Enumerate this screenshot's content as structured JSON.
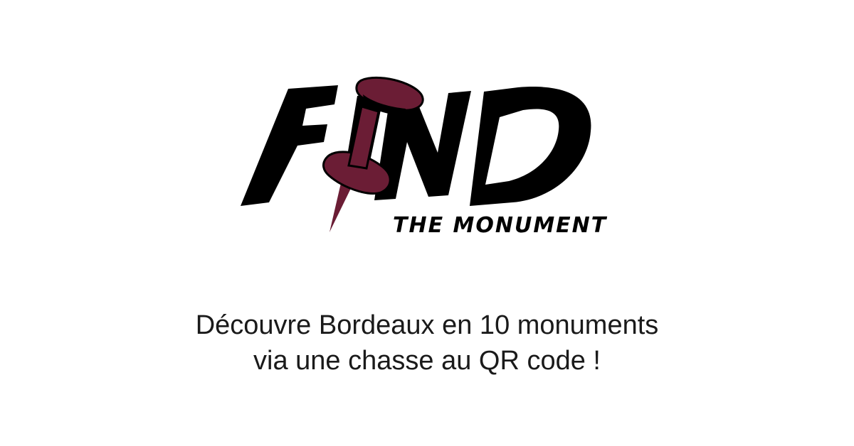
{
  "logo": {
    "word": "FIND",
    "subtitle": "THE MONUMENT",
    "pin_color": "#6b1d35",
    "pin_icon": "pushpin-icon"
  },
  "tagline": {
    "line1": "Découvre Bordeaux en 10 monuments",
    "line2": "via une chasse au QR code !"
  }
}
